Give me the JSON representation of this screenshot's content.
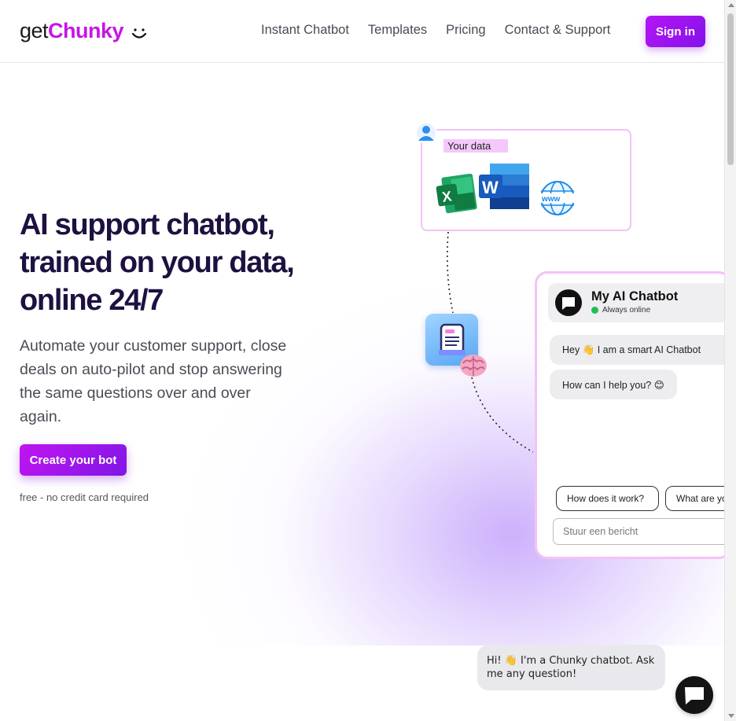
{
  "brand": {
    "get": "get",
    "chunky": "Chunky",
    "accent": "#c715e6"
  },
  "nav": {
    "items": [
      "Instant Chatbot",
      "Templates",
      "Pricing",
      "Contact & Support"
    ],
    "signin": "Sign in"
  },
  "hero": {
    "headline_lines": [
      "AI support chatbot,",
      "trained on your data,",
      "online 24/7"
    ],
    "subhead": "Automate your customer support, close deals on auto-pilot and stop answering the same questions over and over again.",
    "cta": "Create your bot",
    "note": "free - no credit card required"
  },
  "data_card": {
    "label": "Your data",
    "icons": [
      "user-icon",
      "excel-icon",
      "word-icon",
      "www-globe-icon"
    ]
  },
  "chat": {
    "title": "My AI Chatbot",
    "status": "Always online",
    "messages": [
      "Hey 👋 I am a smart AI Chatbot",
      "How can I help you? 😊"
    ],
    "chips": [
      "How does it work?",
      "What are yo"
    ],
    "placeholder": "Stuur een bericht"
  },
  "widget": {
    "greeting": "Hi! 👋 I'm a Chunky chatbot. Ask me any question!"
  },
  "colors": {
    "headline": "#1e1140",
    "button_start": "#c115f0",
    "button_end": "#7f16e6",
    "card_border": "#f2c2f6",
    "online": "#1fbf55"
  }
}
